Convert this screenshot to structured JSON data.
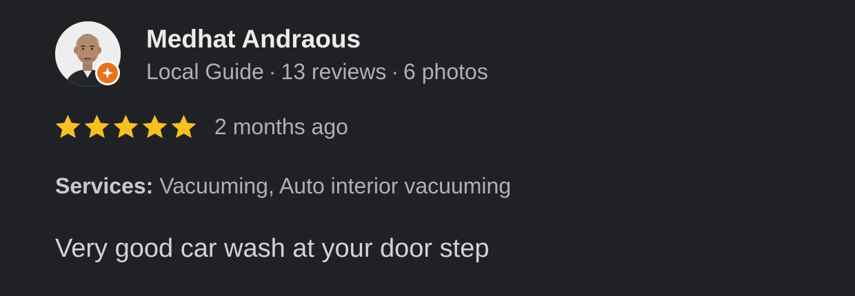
{
  "review": {
    "reviewer": {
      "name": "Medhat Andraous",
      "guide_label": "Local Guide",
      "separator": "·",
      "reviews_count": "13 reviews",
      "photos_count": "6 photos",
      "avatar_icon": "person-photo",
      "badge_icon": "local-guide-star-icon"
    },
    "rating": {
      "stars": 5,
      "max_stars": 5,
      "star_icon": "star-icon",
      "star_color": "#f6bf26"
    },
    "date": "2 months ago",
    "services": {
      "label": "Services:",
      "value": "Vacuuming, Auto interior vacuuming"
    },
    "text": "Very good car wash at your door step"
  },
  "colors": {
    "background": "#202124",
    "name": "#ececec",
    "secondary_text": "#aeb0b4",
    "badge": "#e8711c"
  }
}
